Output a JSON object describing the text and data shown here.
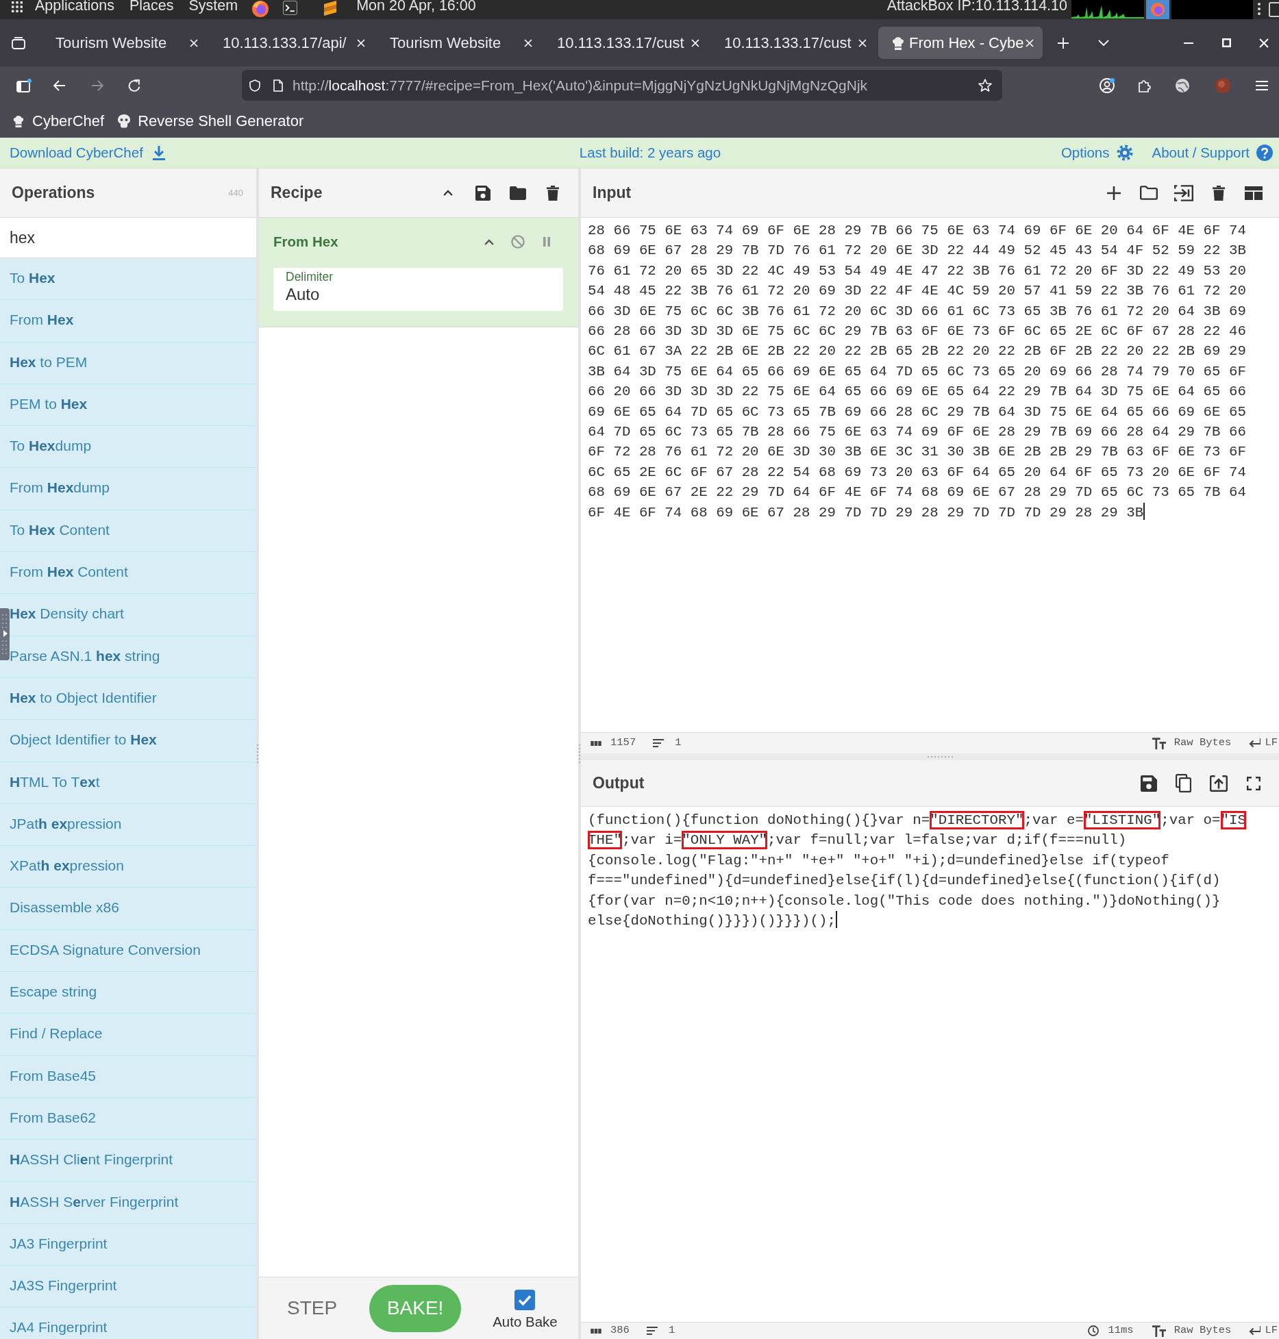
{
  "system_bar": {
    "menus": [
      "Applications",
      "Places",
      "System"
    ],
    "clock": "Mon 20 Apr, 16:00",
    "host": "AttackBox IP:10.113.114.10"
  },
  "browser": {
    "tabs": [
      {
        "title": "Tourism Website",
        "selected": false,
        "favicon": false
      },
      {
        "title": "10.113.133.17/api/",
        "selected": false,
        "favicon": false
      },
      {
        "title": "Tourism Website",
        "selected": false,
        "favicon": false
      },
      {
        "title": "10.113.133.17/cust",
        "selected": false,
        "favicon": false
      },
      {
        "title": "10.113.133.17/cust",
        "selected": false,
        "favicon": false
      },
      {
        "title": "From Hex - Cybe",
        "selected": true,
        "favicon": true
      }
    ],
    "url": "http://**localhost**:7777/#recipe=From_Hex('Auto')&input=MjggNjYgNzUgNkUgNjMgNzQgNjk",
    "bookmarks": [
      "CyberChef",
      "Reverse Shell Generator"
    ]
  },
  "banner": {
    "download": "Download CyberChef",
    "build": "Last build: 2 years ago",
    "options": "Options",
    "about": "About / Support"
  },
  "operations": {
    "title": "Operations",
    "count": "440",
    "search": "hex",
    "items": [
      "To **Hex**",
      "From **Hex**",
      "**Hex** to PEM",
      "PEM to **Hex**",
      "To **Hex**dump",
      "From **Hex**dump",
      "To **Hex** Content",
      "From **Hex** Content",
      "**Hex** Density chart",
      "Parse ASN.1 **hex** string",
      "**Hex** to Object Identifier",
      "Object Identifier to **Hex**",
      "**H**TML To T**ex**t",
      "JPat**h** **ex**pression",
      "XPat**h** **ex**pression",
      "Disassemble x86",
      "ECDSA Signature Conversion",
      "Escape string",
      "Find / Replace",
      "From Base45",
      "From Base62",
      "**H**ASSH Cli**e**nt Fingerprint",
      "**H**ASSH S**e**rver Fingerprint",
      "JA3 Fingerprint",
      "JA3S Fingerprint",
      "JA4 Fingerprint"
    ]
  },
  "recipe": {
    "title": "Recipe",
    "operations": [
      {
        "name": "From Hex",
        "args": [
          {
            "label": "Delimiter",
            "value": "Auto"
          }
        ]
      }
    ],
    "step": "STEP",
    "bake": "BAKE!",
    "auto_bake": {
      "label": "Auto Bake",
      "checked": true
    }
  },
  "input": {
    "title": "Input",
    "lines": [
      "28 66 75 6E 63 74 69 6F 6E 28 29 7B 66 75 6E 63 74 69 6F 6E 20 64 6F 4E 6F 74",
      "68 69 6E 67 28 29 7B 7D 76 61 72 20 6E 3D 22 44 49 52 45 43 54 4F 52 59 22 3B",
      "76 61 72 20 65 3D 22 4C 49 53 54 49 4E 47 22 3B 76 61 72 20 6F 3D 22 49 53 20",
      "54 48 45 22 3B 76 61 72 20 69 3D 22 4F 4E 4C 59 20 57 41 59 22 3B 76 61 72 20",
      "66 3D 6E 75 6C 6C 3B 76 61 72 20 6C 3D 66 61 6C 73 65 3B 76 61 72 20 64 3B 69",
      "66 28 66 3D 3D 3D 6E 75 6C 6C 29 7B 63 6F 6E 73 6F 6C 65 2E 6C 6F 67 28 22 46",
      "6C 61 67 3A 22 2B 6E 2B 22 20 22 2B 65 2B 22 20 22 2B 6F 2B 22 20 22 2B 69 29",
      "3B 64 3D 75 6E 64 65 66 69 6E 65 64 7D 65 6C 73 65 20 69 66 28 74 79 70 65 6F",
      "66 20 66 3D 3D 3D 22 75 6E 64 65 66 69 6E 65 64 22 29 7B 64 3D 75 6E 64 65 66",
      "69 6E 65 64 7D 65 6C 73 65 7B 69 66 28 6C 29 7B 64 3D 75 6E 64 65 66 69 6E 65",
      "64 7D 65 6C 73 65 7B 28 66 75 6E 63 74 69 6F 6E 28 29 7B 69 66 28 64 29 7B 66",
      "6F 72 28 76 61 72 20 6E 3D 30 3B 6E 3C 31 30 3B 6E 2B 2B 29 7B 63 6F 6E 73 6F",
      "6C 65 2E 6C 6F 67 28 22 54 68 69 73 20 63 6F 64 65 20 64 6F 65 73 20 6E 6F 74",
      "68 69 6E 67 2E 22 29 7D 64 6F 4E 6F 74 68 69 6E 67 28 29 7D 65 6C 73 65 7B 64",
      "6F 4E 6F 74 68 69 6E 67 28 29 7D 7D 29 28 29 7D 7D 7D 29 28 29 3B"
    ],
    "status": {
      "length": "1157",
      "lines": "1",
      "encoding": "Raw Bytes",
      "eol": "LF"
    }
  },
  "output": {
    "title": "Output",
    "lines": [
      {
        "segments": [
          {
            "text": "(function(){function doNothing(){}var n=",
            "highlighted": false
          },
          {
            "text": "\"DIRECTORY\"",
            "highlighted": true
          },
          {
            "text": ";var e=",
            "highlighted": false
          },
          {
            "text": "\"LISTING\"",
            "highlighted": true
          },
          {
            "text": ";var o=",
            "highlighted": false
          },
          {
            "text": "\"IS",
            "highlighted": true
          }
        ]
      },
      {
        "segments": [
          {
            "text": "THE\"",
            "highlighted": true
          },
          {
            "text": ";var i=",
            "highlighted": false
          },
          {
            "text": "\"ONLY WAY\"",
            "highlighted": true
          },
          {
            "text": ";var f=null;var l=false;var d;if(f===null)",
            "highlighted": false
          }
        ]
      },
      {
        "segments": [
          {
            "text": "{console.log(\"Flag:\"+n+\" \"+e+\" \"+o+\" \"+i);d=undefined}else if(typeof",
            "highlighted": false
          }
        ]
      },
      {
        "segments": [
          {
            "text": "f===\"undefined\"){d=undefined}else{if(l){d=undefined}else{(function(){if(d)",
            "highlighted": false
          }
        ]
      },
      {
        "segments": [
          {
            "text": "{for(var n=0;n<10;n++){console.log(\"This code does nothing.\")}doNothing()}",
            "highlighted": false
          }
        ]
      },
      {
        "segments": [
          {
            "text": "else{doNothing()}}})()}}})();",
            "highlighted": false
          }
        ]
      }
    ],
    "status": {
      "length": "386",
      "lines": "1",
      "time": "11ms",
      "encoding": "Raw Bytes",
      "eol": "LF"
    }
  }
}
